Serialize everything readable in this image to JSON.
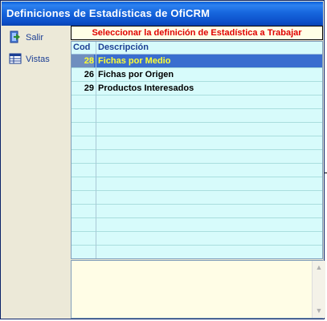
{
  "window": {
    "title": "Definiciones de Estadísticas de  OfiCRM"
  },
  "sidebar": {
    "items": [
      {
        "label": "Salir",
        "icon": "exit-door-icon"
      },
      {
        "label": "Vistas",
        "icon": "table-view-icon"
      }
    ]
  },
  "banner": {
    "text": "Seleccionar la definición de Estadística a Trabajar"
  },
  "grid": {
    "columns": [
      "Cod",
      "Descripción"
    ],
    "rows": [
      {
        "cod": "28",
        "descripcion": "Fichas por Medio",
        "selected": true
      },
      {
        "cod": "26",
        "descripcion": "Fichas por Origen",
        "selected": false
      },
      {
        "cod": "29",
        "descripcion": "Productos Interesados",
        "selected": false
      }
    ]
  },
  "notes": {
    "value": ""
  },
  "colors": {
    "title_bar": "#0c4fc9",
    "banner_text": "#e00000",
    "grid_bg": "#d7fbfb",
    "selected_row": "#3a6ecf",
    "selected_text": "#ffff33"
  }
}
